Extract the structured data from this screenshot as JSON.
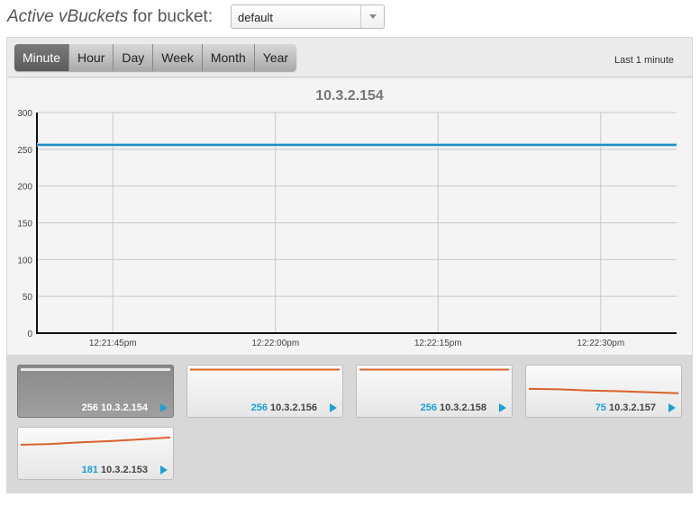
{
  "header": {
    "title_em": "Active vBuckets",
    "title_rest": " for bucket:",
    "bucket_selected": "default"
  },
  "toolbar": {
    "tabs": [
      "Minute",
      "Hour",
      "Day",
      "Week",
      "Month",
      "Year"
    ],
    "active_tab": "Minute",
    "range_label": "Last 1 minute"
  },
  "colors": {
    "main_series": "#1a8bc4",
    "mini_series": "#d9622b",
    "count_text": "#1aa0d8"
  },
  "chart_data": {
    "type": "line",
    "title": "10.3.2.154",
    "xlabel": "",
    "ylabel": "",
    "ylim": [
      0,
      300
    ],
    "yticks": [
      0,
      50,
      100,
      150,
      200,
      250,
      300
    ],
    "xlim": [
      "12:21:38pm",
      "12:22:37pm"
    ],
    "xticks": [
      "12:21:45pm",
      "12:22:00pm",
      "12:22:15pm",
      "12:22:30pm"
    ],
    "series": [
      {
        "x": [
          "12:21:38pm",
          "12:22:37pm"
        ],
        "values": [
          256,
          256
        ]
      }
    ],
    "grid": true
  },
  "servers": [
    {
      "ip": "10.3.2.154",
      "count": "256",
      "active": true,
      "trend": [
        256,
        256
      ]
    },
    {
      "ip": "10.3.2.156",
      "count": "256",
      "active": false,
      "trend": [
        256,
        256
      ]
    },
    {
      "ip": "10.3.2.158",
      "count": "256",
      "active": false,
      "trend": [
        256,
        256
      ]
    },
    {
      "ip": "10.3.2.157",
      "count": "75",
      "active": false,
      "trend": [
        100,
        96,
        86,
        80,
        72,
        64
      ]
    },
    {
      "ip": "10.3.2.153",
      "count": "181",
      "active": false,
      "trend": [
        150,
        156,
        170,
        180,
        194,
        210
      ]
    }
  ]
}
